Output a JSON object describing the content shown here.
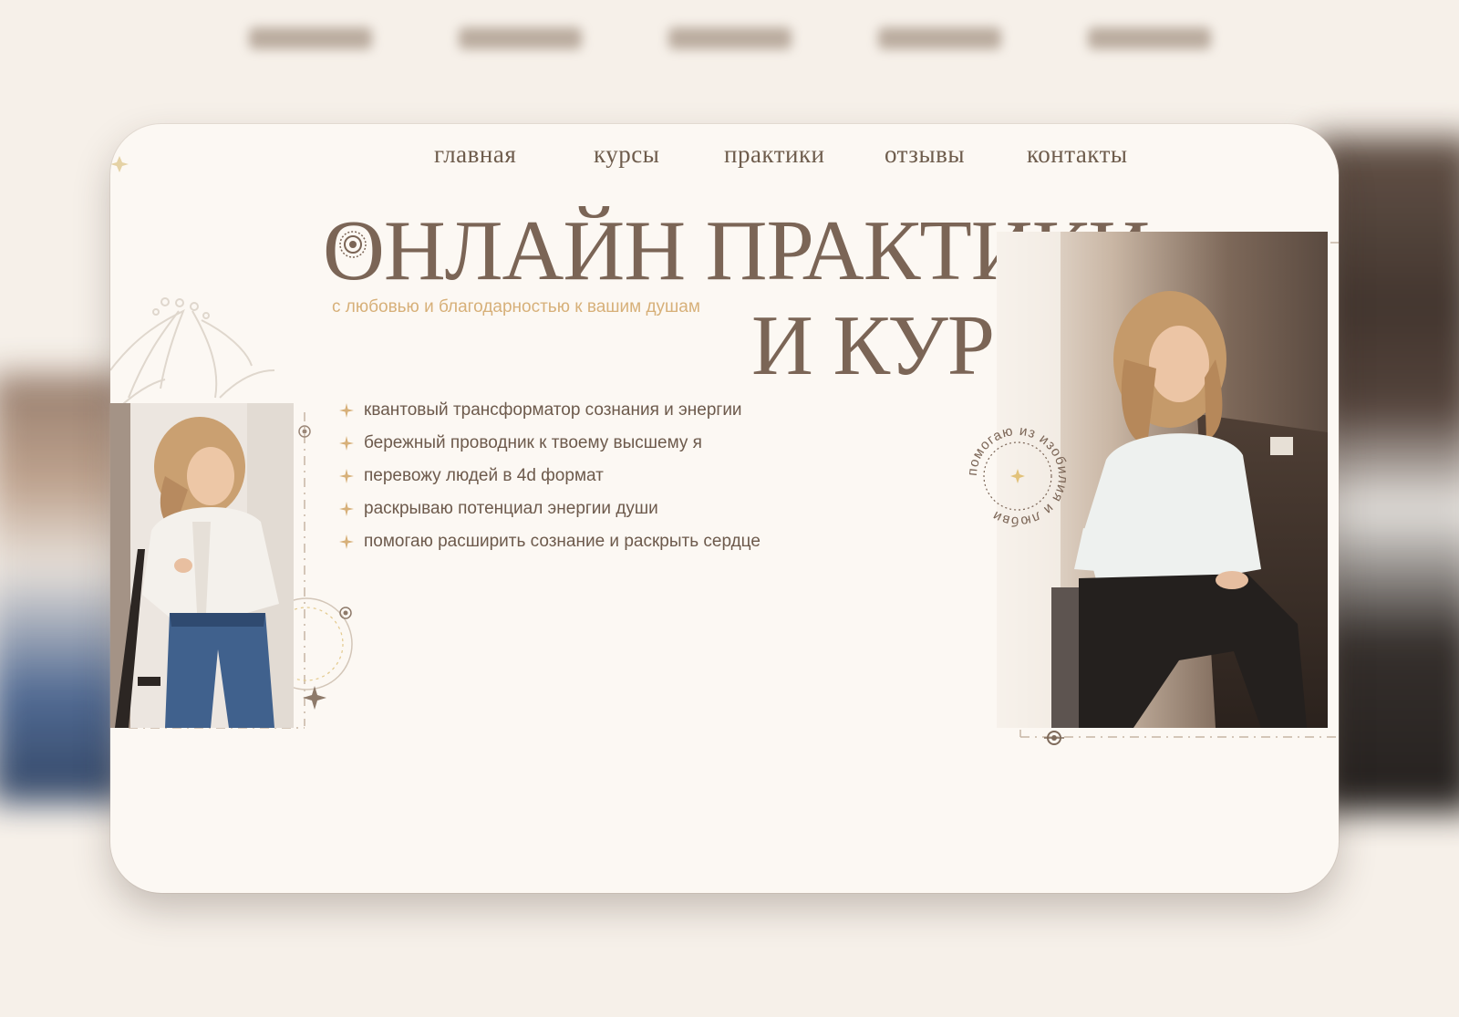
{
  "nav": {
    "items": [
      {
        "label": "главная"
      },
      {
        "label": "курсы"
      },
      {
        "label": "практики"
      },
      {
        "label": "отзывы"
      },
      {
        "label": "контакты"
      }
    ]
  },
  "hero": {
    "title_line1": "ОНЛАЙН ПРАКТИКИ",
    "title_line2": "И КУРСЫ",
    "subtitle": "с любовью и благодарностью к вашим душам",
    "features": [
      "квантовый трансформатор сознания и энергии",
      "бережный проводник к твоему высшему я",
      "перевожу людей в 4d формат",
      "раскрываю потенциал энергии души",
      "помогаю расширить сознание и раскрыть сердце"
    ],
    "badge_text": "помогаю из изобилия и любви"
  },
  "colors": {
    "primary_text": "#7b6556",
    "accent_gold": "#d7b079",
    "background": "#fcf8f3"
  },
  "icons": {
    "feature_bullet": "four-point-star-icon",
    "title_ornament": "mandala-circle-icon",
    "badge_center": "sparkle-icon"
  }
}
